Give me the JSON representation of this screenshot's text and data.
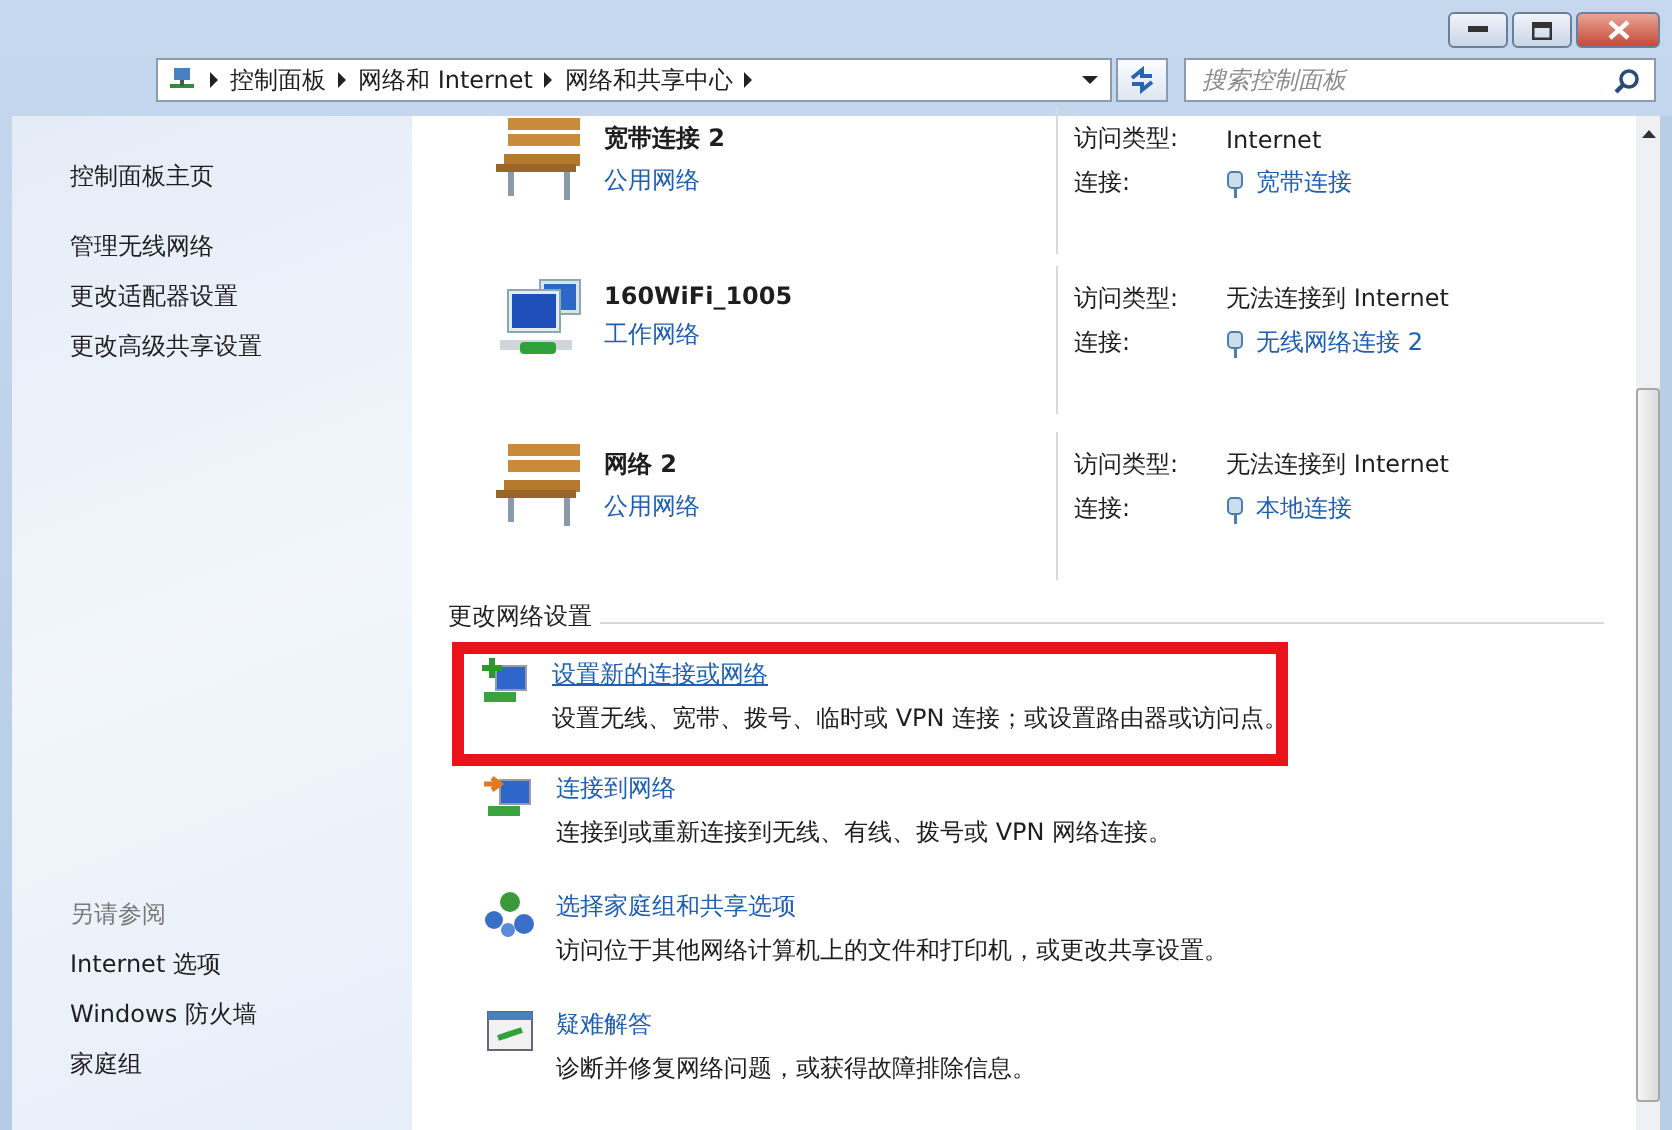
{
  "address_bar": {
    "crumbs": [
      "控制面板",
      "网络和 Internet",
      "网络和共享中心"
    ]
  },
  "search": {
    "placeholder": "搜索控制面板"
  },
  "sidebar": {
    "items": [
      "控制面板主页",
      "管理无线网络",
      "更改适配器设置",
      "更改高级共享设置"
    ],
    "see_also": {
      "heading": "另请参阅",
      "items": [
        "Internet 选项",
        "Windows 防火墙",
        "家庭组"
      ]
    }
  },
  "networks": [
    {
      "kind": "bench",
      "name": "宽带连接  2",
      "type": "公用网络",
      "access_label": "访问类型:",
      "access": "Internet",
      "connection_label": "连接:",
      "connection": "宽带连接"
    },
    {
      "kind": "computers",
      "name": "160WiFi_1005",
      "type": "工作网络",
      "access_label": "访问类型:",
      "access": "无法连接到 Internet",
      "connection_label": "连接:",
      "connection": "无线网络连接 2"
    },
    {
      "kind": "bench",
      "name": "网络  2",
      "type": "公用网络",
      "access_label": "访问类型:",
      "access": "无法连接到 Internet",
      "connection_label": "连接:",
      "connection": "本地连接"
    }
  ],
  "change_settings": {
    "heading": "更改网络设置",
    "tasks": [
      {
        "kind": "new",
        "title": "设置新的连接或网络",
        "description": "设置无线、宽带、拨号、临时或 VPN 连接；或设置路由器或访问点。",
        "highlighted": true
      },
      {
        "kind": "connect",
        "title": "连接到网络",
        "description": "连接到或重新连接到无线、有线、拨号或 VPN 网络连接。",
        "highlighted": false
      },
      {
        "kind": "homegroup",
        "title": "选择家庭组和共享选项",
        "description": "访问位于其他网络计算机上的文件和打印机，或更改共享设置。",
        "highlighted": false
      },
      {
        "kind": "troubleshoot",
        "title": "疑难解答",
        "description": "诊断并修复网络问题，或获得故障排除信息。",
        "highlighted": false
      }
    ]
  }
}
